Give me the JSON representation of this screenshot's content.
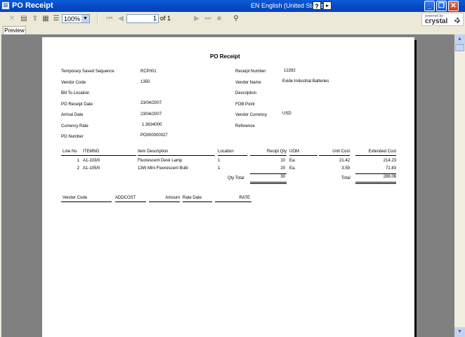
{
  "window": {
    "title": "PO Receipt",
    "language": "EN English (United States)",
    "help": "?",
    "minimize": "_",
    "maximize": "❐",
    "close": "✕"
  },
  "toolbar": {
    "zoom": "100%",
    "page": "1",
    "of_pages": "of 1",
    "brand_top": "powered by",
    "brand": "crystal"
  },
  "tabs": [
    "Preview"
  ],
  "report": {
    "title": "PO Receipt",
    "left_fields": [
      {
        "label": "Temporary Saved Sequence",
        "value": "RCP001"
      },
      {
        "label": "Vendor Code",
        "value": "1350"
      },
      {
        "label": "Bill To Location",
        "value": ""
      },
      {
        "label": "PO Receipt Date",
        "value": "23/04/2007"
      },
      {
        "label": "Arrival Date",
        "value": "23/04/2007"
      },
      {
        "label": "Currency Rate",
        "value": "1.3634000"
      },
      {
        "label": "PO Number",
        "value": "PO000000027"
      }
    ],
    "right_fields": [
      {
        "label": "Receipt Number",
        "value": "12282"
      },
      {
        "label": "Vendor Name",
        "value": "Exide Industrial Batteries"
      },
      {
        "label": "Description",
        "value": ""
      },
      {
        "label": "FOB Point",
        "value": ""
      },
      {
        "label": "Vendor Currency",
        "value": "USD"
      },
      {
        "label": "Reference",
        "value": ""
      }
    ],
    "columns": [
      "Line No",
      "ITEMNO",
      "Item Description",
      "Location",
      "Recipt Qty",
      "UOM",
      "Unit Cost",
      "Extended Cost"
    ],
    "rows": [
      [
        "1",
        "A1-103/0",
        "Fluorescent Desk Lamp",
        "1",
        "10",
        "Ea.",
        "21.42",
        "214.23"
      ],
      [
        "2",
        "A1-105/0",
        "13W Mini Fluorescent Bulb",
        "1",
        "20",
        "Ea.",
        "3.59",
        "71.83"
      ]
    ],
    "qty_total_label": "Qty Total",
    "qty_total": "30",
    "total_label": "Total",
    "total": "286.06",
    "cost_columns": [
      "Vendor Code",
      "ADDCOST",
      "Amount",
      "Rate Date",
      "RATE"
    ]
  }
}
